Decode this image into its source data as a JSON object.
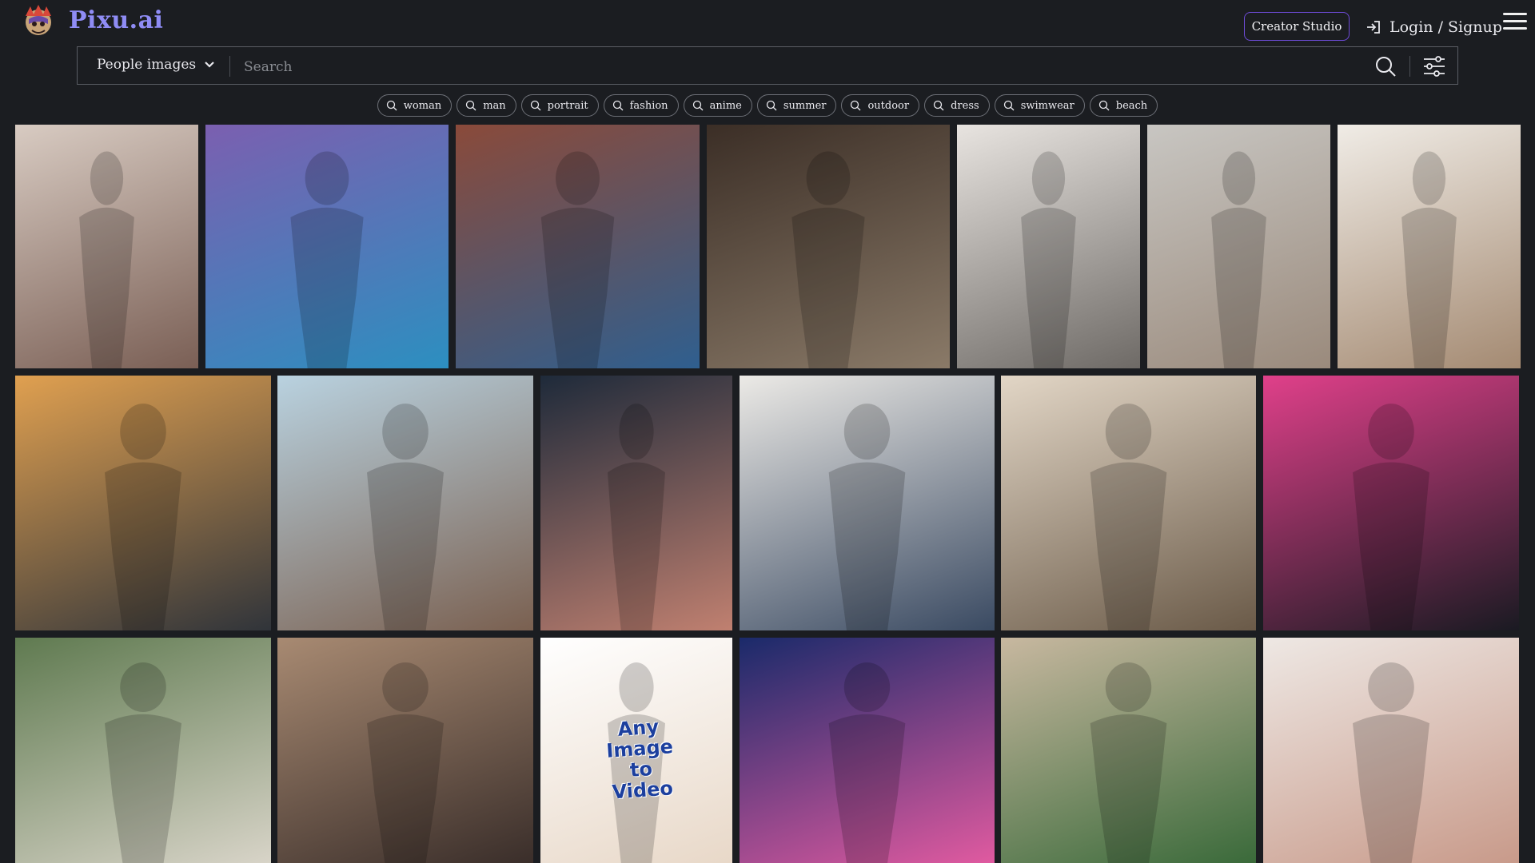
{
  "header": {
    "brand": "Pixu.ai",
    "creator_studio": "Creator Studio",
    "login": "Login / Signup"
  },
  "search": {
    "category": "People images",
    "placeholder": "Search"
  },
  "tags": [
    "woman",
    "man",
    "portrait",
    "fashion",
    "anime",
    "summer",
    "outdoor",
    "dress",
    "swimwear",
    "beach"
  ],
  "promo": {
    "text": "Any Image to Video"
  },
  "gallery": {
    "tiles": [
      {
        "name": "photo-woman-lingerie-bedroom",
        "colors": [
          "#d8cbc2",
          "#7a5f55"
        ]
      },
      {
        "name": "illustration-woman-bikini-wave",
        "colors": [
          "#7b5fb0",
          "#2c8fc0"
        ]
      },
      {
        "name": "photo-redhead-denim-graffiti",
        "colors": [
          "#8a4a3a",
          "#2f5f8f"
        ]
      },
      {
        "name": "photo-woman-cafe-denim",
        "colors": [
          "#3b2e26",
          "#8a7a68"
        ]
      },
      {
        "name": "photo-woman-white-sweater-bed",
        "colors": [
          "#e8e4e0",
          "#6e6a66"
        ]
      },
      {
        "name": "photo-woman-blue-bikini-window",
        "colors": [
          "#c8c6c2",
          "#9a8a7c"
        ]
      },
      {
        "name": "photo-woman-leopard-bikini",
        "colors": [
          "#f0ece6",
          "#a48a72"
        ]
      },
      {
        "name": "photo-woman-silhouette-sunset",
        "colors": [
          "#e0a050",
          "#30343a"
        ]
      },
      {
        "name": "illustration-anime-woman-black-top",
        "colors": [
          "#b9d2e0",
          "#7a6050"
        ]
      },
      {
        "name": "photo-woman-black-lingerie-studio",
        "colors": [
          "#1e2a3a",
          "#c08070"
        ]
      },
      {
        "name": "photo-man-fedora-denim",
        "colors": [
          "#eceae6",
          "#3a4a62"
        ]
      },
      {
        "name": "photo-man-beige-suit",
        "colors": [
          "#e2d6c6",
          "#6a5a48"
        ]
      },
      {
        "name": "illustration-redhead-latex-dress",
        "colors": [
          "#e0408a",
          "#1a1a22"
        ]
      },
      {
        "name": "photo-blonde-girl-field",
        "colors": [
          "#5f7a50",
          "#d8d4c8"
        ]
      },
      {
        "name": "illustration-woman-corset-street",
        "colors": [
          "#a88a72",
          "#3a2e2a"
        ]
      },
      {
        "name": "promo-any-image-to-video",
        "colors": [
          "#ffffff",
          "#e8d8c8"
        ]
      },
      {
        "name": "photo-woman-neon-street-night",
        "colors": [
          "#1a2a6a",
          "#e05aa0"
        ]
      },
      {
        "name": "photo-woman-blue-swimsuit-dunes",
        "colors": [
          "#c8b8a0",
          "#3a6a3a"
        ]
      },
      {
        "name": "photo-woman-pink-lingerie-bed",
        "colors": [
          "#eee8e4",
          "#c89a8a"
        ]
      }
    ]
  }
}
